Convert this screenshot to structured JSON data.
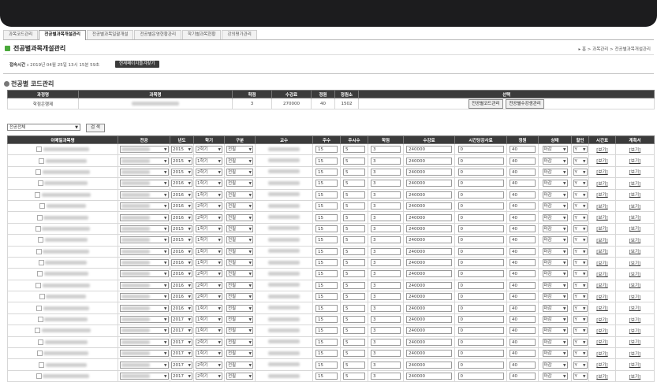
{
  "tabs": [
    {
      "label": "과목코드관리"
    },
    {
      "label": "전공별과목개설관리"
    },
    {
      "label": "전공별과목일괄개설"
    },
    {
      "label": "전공별운영현황관리"
    },
    {
      "label": "학기별과목현황"
    },
    {
      "label": "강의평가관리"
    }
  ],
  "page_title": "전공별과목개설관리",
  "breadcrumb": "▸ 홈 > 과목관리 > 전공별과목개설관리",
  "access": {
    "label": "접속시간 :",
    "value": "2019년 04월 25일 13시 15분 59초",
    "button": "현재페이지즐겨찾기"
  },
  "code_section": {
    "title": "전공별 코드관리",
    "headers": [
      "과정명",
      "과목명",
      "학점",
      "수강료",
      "정원",
      "정원소",
      "선택"
    ],
    "row": {
      "course": "학점은행제",
      "credit": "3",
      "fee": "270000",
      "quota": "40",
      "quota2": "1502"
    },
    "buttons": [
      "전공별코드관리",
      "전공별수강생관리"
    ]
  },
  "filter": {
    "selected": "전공전체",
    "search_label": "검 색"
  },
  "main_headers": [
    "이메일과목명",
    "전공",
    "년도",
    "학기",
    "구분",
    "교수",
    "주수",
    "주시수",
    "학점",
    "수강료",
    "시간당강사료",
    "정원",
    "상태",
    "할인",
    "시간표",
    "계획서"
  ],
  "rows": [
    {
      "year": "2015",
      "term": "2학기",
      "type": "전필",
      "weeks": "15",
      "hours": "5",
      "credit": "3",
      "fee": "240000",
      "pay": "0",
      "quota": "40",
      "status": "마감",
      "disc": "Y",
      "view1": "[보기]",
      "view2": "[보기]"
    },
    {
      "year": "2015",
      "term": "1학기",
      "type": "전필",
      "weeks": "15",
      "hours": "5",
      "credit": "3",
      "fee": "240000",
      "pay": "0",
      "quota": "40",
      "status": "마감",
      "disc": "Y",
      "view1": "[보기]",
      "view2": "[보기]"
    },
    {
      "year": "2015",
      "term": "2학기",
      "type": "전필",
      "weeks": "15",
      "hours": "5",
      "credit": "3",
      "fee": "240000",
      "pay": "0",
      "quota": "40",
      "status": "마감",
      "disc": "Y",
      "view1": "[보기]",
      "view2": "[보기]"
    },
    {
      "year": "2016",
      "term": "1학기",
      "type": "전필",
      "weeks": "15",
      "hours": "5",
      "credit": "3",
      "fee": "240000",
      "pay": "0",
      "quota": "40",
      "status": "마감",
      "disc": "Y",
      "view1": "[보기]",
      "view2": "[보기]"
    },
    {
      "year": "2016",
      "term": "1학기",
      "type": "전필",
      "weeks": "15",
      "hours": "5",
      "credit": "3",
      "fee": "240000",
      "pay": "0",
      "quota": "40",
      "status": "마감",
      "disc": "Y",
      "view1": "[보기]",
      "view2": "[보기]"
    },
    {
      "year": "2016",
      "term": "2학기",
      "type": "전필",
      "weeks": "15",
      "hours": "5",
      "credit": "3",
      "fee": "240000",
      "pay": "0",
      "quota": "40",
      "status": "마감",
      "disc": "Y",
      "view1": "[보기]",
      "view2": "[보기]"
    },
    {
      "year": "2016",
      "term": "2학기",
      "type": "전필",
      "weeks": "15",
      "hours": "5",
      "credit": "3",
      "fee": "240000",
      "pay": "0",
      "quota": "40",
      "status": "마감",
      "disc": "Y",
      "view1": "[보기]",
      "view2": "[보기]"
    },
    {
      "year": "2015",
      "term": "1학기",
      "type": "전필",
      "weeks": "15",
      "hours": "5",
      "credit": "3",
      "fee": "240000",
      "pay": "0",
      "quota": "40",
      "status": "마감",
      "disc": "Y",
      "view1": "[보기]",
      "view2": "[보기]"
    },
    {
      "year": "2015",
      "term": "1학기",
      "type": "전필",
      "weeks": "15",
      "hours": "5",
      "credit": "3",
      "fee": "240000",
      "pay": "0",
      "quota": "40",
      "status": "마감",
      "disc": "Y",
      "view1": "[보기]",
      "view2": "[보기]"
    },
    {
      "year": "2016",
      "term": "1학기",
      "type": "전필",
      "weeks": "15",
      "hours": "5",
      "credit": "3",
      "fee": "240000",
      "pay": "0",
      "quota": "40",
      "status": "마감",
      "disc": "Y",
      "view1": "[보기]",
      "view2": "[보기]"
    },
    {
      "year": "2016",
      "term": "1학기",
      "type": "전필",
      "weeks": "15",
      "hours": "5",
      "credit": "3",
      "fee": "240000",
      "pay": "0",
      "quota": "40",
      "status": "마감",
      "disc": "Y",
      "view1": "[보기]",
      "view2": "[보기]"
    },
    {
      "year": "2016",
      "term": "2학기",
      "type": "전필",
      "weeks": "15",
      "hours": "5",
      "credit": "3",
      "fee": "240000",
      "pay": "0",
      "quota": "40",
      "status": "마감",
      "disc": "Y",
      "view1": "[보기]",
      "view2": "[보기]"
    },
    {
      "year": "2016",
      "term": "2학기",
      "type": "전필",
      "weeks": "15",
      "hours": "5",
      "credit": "3",
      "fee": "240000",
      "pay": "0",
      "quota": "40",
      "status": "마감",
      "disc": "Y",
      "view1": "[보기]",
      "view2": "[보기]"
    },
    {
      "year": "2016",
      "term": "2학기",
      "type": "전필",
      "weeks": "15",
      "hours": "5",
      "credit": "3",
      "fee": "240000",
      "pay": "0",
      "quota": "40",
      "status": "마감",
      "disc": "Y",
      "view1": "[보기]",
      "view2": "[보기]"
    },
    {
      "year": "2016",
      "term": "1학기",
      "type": "전필",
      "weeks": "15",
      "hours": "5",
      "credit": "3",
      "fee": "240000",
      "pay": "0",
      "quota": "40",
      "status": "마감",
      "disc": "Y",
      "view1": "[보기]",
      "view2": "[보기]"
    },
    {
      "year": "2017",
      "term": "1학기",
      "type": "전필",
      "weeks": "15",
      "hours": "5",
      "credit": "3",
      "fee": "240000",
      "pay": "0",
      "quota": "40",
      "status": "마감",
      "disc": "Y",
      "view1": "[보기]",
      "view2": "[보기]"
    },
    {
      "year": "2017",
      "term": "1학기",
      "type": "전필",
      "weeks": "15",
      "hours": "5",
      "credit": "3",
      "fee": "240000",
      "pay": "0",
      "quota": "40",
      "status": "마감",
      "disc": "Y",
      "view1": "[보기]",
      "view2": "[보기]"
    },
    {
      "year": "2017",
      "term": "2학기",
      "type": "전필",
      "weeks": "15",
      "hours": "5",
      "credit": "3",
      "fee": "240000",
      "pay": "0",
      "quota": "40",
      "status": "마감",
      "disc": "Y",
      "view1": "[보기]",
      "view2": "[보기]"
    },
    {
      "year": "2017",
      "term": "1학기",
      "type": "전필",
      "weeks": "15",
      "hours": "5",
      "credit": "3",
      "fee": "240000",
      "pay": "0",
      "quota": "40",
      "status": "마감",
      "disc": "Y",
      "view1": "[보기]",
      "view2": "[보기]"
    },
    {
      "year": "2017",
      "term": "2학기",
      "type": "전필",
      "weeks": "15",
      "hours": "5",
      "credit": "3",
      "fee": "240000",
      "pay": "0",
      "quota": "40",
      "status": "마감",
      "disc": "Y",
      "view1": "[보기]",
      "view2": "[보기]"
    },
    {
      "year": "2017",
      "term": "2학기",
      "type": "전필",
      "weeks": "15",
      "hours": "5",
      "credit": "3",
      "fee": "240000",
      "pay": "0",
      "quota": "40",
      "status": "마감",
      "disc": "Y",
      "view1": "[보기]",
      "view2": "[보기]"
    }
  ]
}
